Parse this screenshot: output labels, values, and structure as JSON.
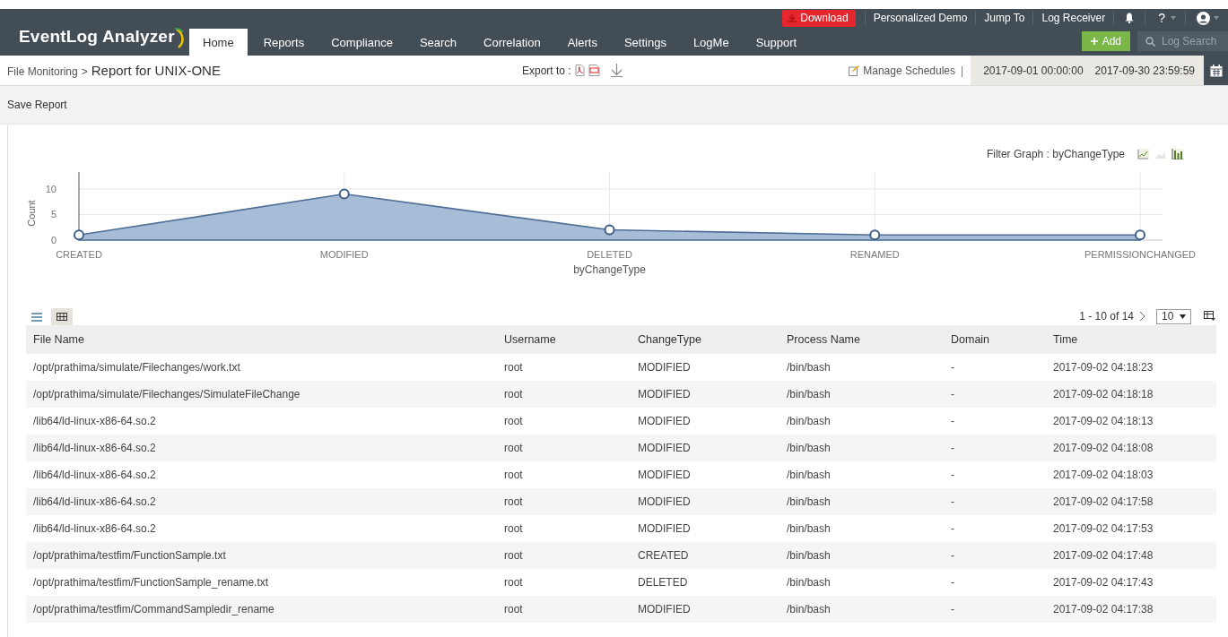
{
  "app": {
    "logo": "EventLog Analyzer"
  },
  "top_links": {
    "download": "Download",
    "items": [
      "Personalized Demo",
      "Jump To",
      "Log Receiver"
    ],
    "help": "?"
  },
  "tabs": [
    {
      "label": "Home",
      "selected": true
    },
    {
      "label": "Reports",
      "selected": false
    },
    {
      "label": "Compliance",
      "selected": false
    },
    {
      "label": "Search",
      "selected": false
    },
    {
      "label": "Correlation",
      "selected": false
    },
    {
      "label": "Alerts",
      "selected": false
    },
    {
      "label": "Settings",
      "selected": false
    },
    {
      "label": "LogMe",
      "selected": false
    },
    {
      "label": "Support",
      "selected": false
    }
  ],
  "add_button": "Add",
  "log_search": {
    "placeholder": "Log Search"
  },
  "breadcrumb": {
    "parent": "File Monitoring",
    "separator": ">",
    "current": "Report for UNIX-ONE"
  },
  "export": {
    "label": "Export to :"
  },
  "manage_schedules": "Manage Schedules",
  "separator": "|",
  "date_range": {
    "start": "2017-09-01 00:00:00",
    "end": "2017-09-30 23:59:59"
  },
  "save_report": "Save Report",
  "filter_graph": "Filter Graph : byChangeType",
  "chart": {
    "chart_data": {
      "type": "area",
      "xlabel": "byChangeType",
      "ylabel": "Count",
      "categories": [
        "CREATED",
        "MODIFIED",
        "DELETED",
        "RENAMED",
        "PERMISSIONCHANGED"
      ],
      "series": [
        {
          "color": "#a7bcd6",
          "values": [
            1,
            9,
            2,
            1,
            1
          ]
        }
      ],
      "grid": true,
      "ylim": [
        0,
        13.3
      ],
      "yticks": [
        0,
        5,
        10
      ]
    }
  },
  "table": {
    "view_modes": [
      {
        "kind": "list",
        "selected": false
      },
      {
        "kind": "grid",
        "selected": true
      }
    ],
    "pagination": "1 - 10 of 14",
    "page_size": "10",
    "columns": [
      "File Name",
      "Username",
      "ChangeType",
      "Process Name",
      "Domain",
      "Time"
    ],
    "rows": [
      [
        "/opt/prathima/simulate/Filechanges/work.txt",
        "root",
        "MODIFIED",
        "/bin/bash",
        "-",
        "2017-09-02 04:18:23"
      ],
      [
        "/opt/prathima/simulate/Filechanges/SimulateFileChange",
        "root",
        "MODIFIED",
        "/bin/bash",
        "-",
        "2017-09-02 04:18:18"
      ],
      [
        "/lib64/ld-linux-x86-64.so.2",
        "root",
        "MODIFIED",
        "/bin/bash",
        "-",
        "2017-09-02 04:18:13"
      ],
      [
        "/lib64/ld-linux-x86-64.so.2",
        "root",
        "MODIFIED",
        "/bin/bash",
        "-",
        "2017-09-02 04:18:08"
      ],
      [
        "/lib64/ld-linux-x86-64.so.2",
        "root",
        "MODIFIED",
        "/bin/bash",
        "-",
        "2017-09-02 04:18:03"
      ],
      [
        "/lib64/ld-linux-x86-64.so.2",
        "root",
        "MODIFIED",
        "/bin/bash",
        "-",
        "2017-09-02 04:17:58"
      ],
      [
        "/lib64/ld-linux-x86-64.so.2",
        "root",
        "MODIFIED",
        "/bin/bash",
        "-",
        "2017-09-02 04:17:53"
      ],
      [
        "/opt/prathima/testfim/FunctionSample.txt",
        "root",
        "CREATED",
        "/bin/bash",
        "-",
        "2017-09-02 04:17:48"
      ],
      [
        "/opt/prathima/testfim/FunctionSample_rename.txt",
        "root",
        "DELETED",
        "/bin/bash",
        "-",
        "2017-09-02 04:17:43"
      ],
      [
        "/opt/prathima/testfim/CommandSampledir_rename",
        "root",
        "MODIFIED",
        "/bin/bash",
        "-",
        "2017-09-02 04:17:38"
      ]
    ]
  }
}
